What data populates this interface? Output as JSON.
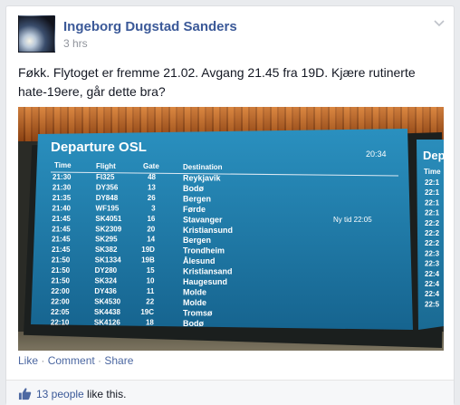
{
  "post": {
    "author": "Ingeborg Dugstad Sanders",
    "time": "3 hrs",
    "text": "Føkk. Flytoget er fremme 21.02. Avgang 21.45 fra 19D. Kjære rutinerte hate-19ere, går dette bra?"
  },
  "board": {
    "title": "Departure OSL",
    "clock": "20:34",
    "headers": {
      "time": "Time",
      "flight": "Flight",
      "gate": "Gate",
      "destination": "Destination"
    },
    "right_title": "Dep",
    "right_time_header": "Time",
    "right_times": [
      "22:1",
      "22:1",
      "22:1",
      "22:1",
      "22:2",
      "22:2",
      "22:2",
      "22:3",
      "22:3",
      "22:4",
      "22:4",
      "22:4",
      "22:5"
    ],
    "rows": [
      {
        "time": "21:30",
        "flight": "FI325",
        "gate": "48",
        "destination": "Reykjavik",
        "remark": ""
      },
      {
        "time": "21:30",
        "flight": "DY356",
        "gate": "13",
        "destination": "Bodø",
        "remark": ""
      },
      {
        "time": "21:35",
        "flight": "DY848",
        "gate": "26",
        "destination": "Bergen",
        "remark": ""
      },
      {
        "time": "21:40",
        "flight": "WF195",
        "gate": "3",
        "destination": "Førde",
        "remark": ""
      },
      {
        "time": "21:45",
        "flight": "SK4051",
        "gate": "16",
        "destination": "Stavanger",
        "remark": "Ny tid 22:05"
      },
      {
        "time": "21:45",
        "flight": "SK2309",
        "gate": "20",
        "destination": "Kristiansund",
        "remark": ""
      },
      {
        "time": "21:45",
        "flight": "SK295",
        "gate": "14",
        "destination": "Bergen",
        "remark": ""
      },
      {
        "time": "21:45",
        "flight": "SK382",
        "gate": "19D",
        "destination": "Trondheim",
        "remark": ""
      },
      {
        "time": "21:50",
        "flight": "SK1334",
        "gate": "19B",
        "destination": "Ålesund",
        "remark": ""
      },
      {
        "time": "21:50",
        "flight": "DY280",
        "gate": "15",
        "destination": "Kristiansand",
        "remark": ""
      },
      {
        "time": "21:50",
        "flight": "SK324",
        "gate": "10",
        "destination": "Haugesund",
        "remark": ""
      },
      {
        "time": "22:00",
        "flight": "DY436",
        "gate": "11",
        "destination": "Molde",
        "remark": ""
      },
      {
        "time": "22:00",
        "flight": "SK4530",
        "gate": "22",
        "destination": "Molde",
        "remark": ""
      },
      {
        "time": "22:05",
        "flight": "SK4438",
        "gate": "19C",
        "destination": "Tromsø",
        "remark": ""
      },
      {
        "time": "22:10",
        "flight": "SK4126",
        "gate": "18",
        "destination": "Bodø",
        "remark": ""
      }
    ]
  },
  "actions": {
    "like": "Like",
    "comment": "Comment",
    "share": "Share",
    "separator": " · "
  },
  "likes": {
    "count_text": "13 people",
    "suffix": " like this."
  },
  "colors": {
    "link": "#3b5998",
    "board_blue": "#1e7aa8",
    "muted": "#90949c"
  },
  "icons": {
    "avatar": "profile-photo",
    "menu": "chevron-down-icon",
    "like": "thumbs-up-icon"
  }
}
